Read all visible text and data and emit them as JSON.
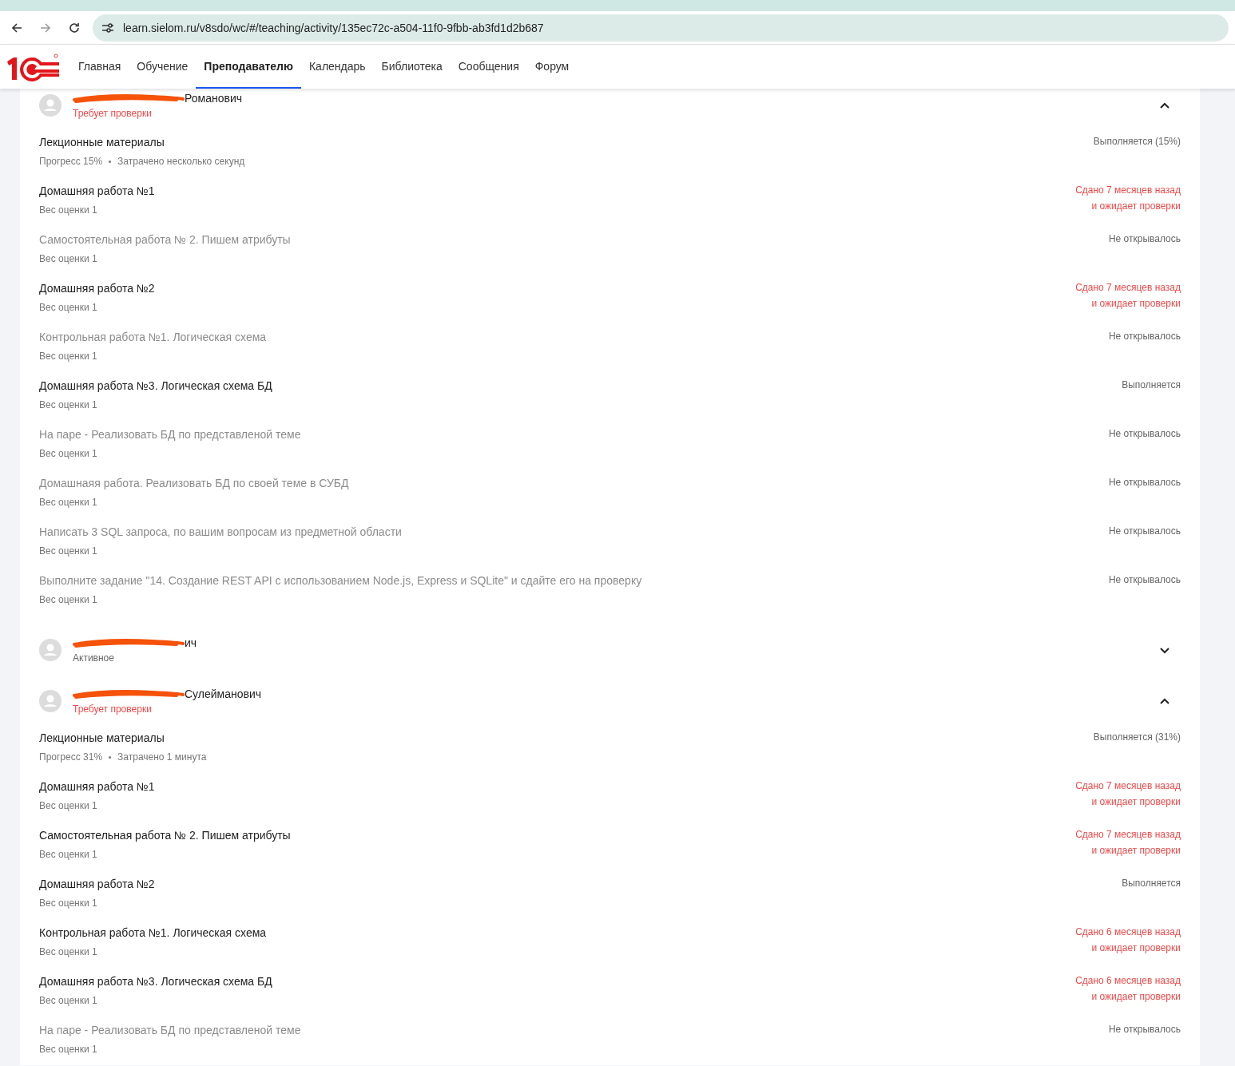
{
  "browser": {
    "url": "learn.sielom.ru/v8sdo/wc/#/teaching/activity/135ec72c-a504-11f0-9fbb-ab3fd1d2b687"
  },
  "nav": [
    {
      "label": "Главная",
      "selected": false
    },
    {
      "label": "Обучение",
      "selected": false
    },
    {
      "label": "Преподавателю",
      "selected": true
    },
    {
      "label": "Календарь",
      "selected": false
    },
    {
      "label": "Библиотека",
      "selected": false
    },
    {
      "label": "Сообщения",
      "selected": false
    },
    {
      "label": "Форум",
      "selected": false
    }
  ],
  "students": [
    {
      "name_visible": "Романович",
      "status": "Требует проверки",
      "needs_review": true,
      "expanded": true,
      "items": [
        {
          "title": "Лекционные материалы",
          "opened": true,
          "meta": [
            "Прогресс 15%",
            "Затрачено несколько секунд"
          ],
          "status": [
            "Выполняется (15%)"
          ],
          "needs_review": false
        },
        {
          "title": "Домашняя работа №1",
          "opened": true,
          "meta": [
            "Вес оценки 1"
          ],
          "status": [
            "Сдано 7 месяцев назад",
            "и ожидает проверки"
          ],
          "needs_review": true
        },
        {
          "title": "Самостоятельная работа № 2. Пишем атрибуты",
          "opened": false,
          "meta": [
            "Вес оценки 1"
          ],
          "status": [
            "Не открывалось"
          ],
          "needs_review": false
        },
        {
          "title": "Домашняя работа №2",
          "opened": true,
          "meta": [
            "Вес оценки 1"
          ],
          "status": [
            "Сдано 7 месяцев назад",
            "и ожидает проверки"
          ],
          "needs_review": true
        },
        {
          "title": "Контрольная работа №1. Логическая схема",
          "opened": false,
          "meta": [
            "Вес оценки 1"
          ],
          "status": [
            "Не открывалось"
          ],
          "needs_review": false
        },
        {
          "title": "Домашняя работа №3. Логическая схема БД",
          "opened": true,
          "meta": [
            "Вес оценки 1"
          ],
          "status": [
            "Выполняется"
          ],
          "needs_review": false
        },
        {
          "title": "На паре - Реализовать БД по представленой теме",
          "opened": false,
          "meta": [
            "Вес оценки 1"
          ],
          "status": [
            "Не открывалось"
          ],
          "needs_review": false
        },
        {
          "title": "Домашнаяя работа. Реализовать БД по своей теме в СУБД",
          "opened": false,
          "meta": [
            "Вес оценки 1"
          ],
          "status": [
            "Не открывалось"
          ],
          "needs_review": false
        },
        {
          "title": "Написать 3 SQL запроса, по вашим вопросам из предметной области",
          "opened": false,
          "meta": [
            "Вес оценки 1"
          ],
          "status": [
            "Не открывалось"
          ],
          "needs_review": false
        },
        {
          "title": "Выполните задание \"14. Создание REST API с использованием Node.js, Express и SQLite\" и сдайте его на проверку",
          "opened": false,
          "meta": [
            "Вес оценки 1"
          ],
          "status": [
            "Не открывалось"
          ],
          "needs_review": false
        }
      ]
    },
    {
      "name_visible": "ич",
      "status": "Активное",
      "needs_review": false,
      "expanded": false
    },
    {
      "name_visible": "Сулейманович",
      "status": "Требует проверки",
      "needs_review": true,
      "expanded": true,
      "items": [
        {
          "title": "Лекционные материалы",
          "opened": true,
          "meta": [
            "Прогресс 31%",
            "Затрачено 1 минута"
          ],
          "status": [
            "Выполняется (31%)"
          ],
          "needs_review": false
        },
        {
          "title": "Домашняя работа №1",
          "opened": true,
          "meta": [
            "Вес оценки 1"
          ],
          "status": [
            "Сдано 7 месяцев назад",
            "и ожидает проверки"
          ],
          "needs_review": true
        },
        {
          "title": "Самостоятельная работа № 2. Пишем атрибуты",
          "opened": true,
          "meta": [
            "Вес оценки 1"
          ],
          "status": [
            "Сдано 7 месяцев назад",
            "и ожидает проверки"
          ],
          "needs_review": true
        },
        {
          "title": "Домашняя работа №2",
          "opened": true,
          "meta": [
            "Вес оценки 1"
          ],
          "status": [
            "Выполняется"
          ],
          "needs_review": false
        },
        {
          "title": "Контрольная работа №1. Логическая схема",
          "opened": true,
          "meta": [
            "Вес оценки 1"
          ],
          "status": [
            "Сдано 6 месяцев назад",
            "и ожидает проверки"
          ],
          "needs_review": true
        },
        {
          "title": "Домашняя работа №3. Логическая схема БД",
          "opened": true,
          "meta": [
            "Вес оценки 1"
          ],
          "status": [
            "Сдано 6 месяцев назад",
            "и ожидает проверки"
          ],
          "needs_review": true
        },
        {
          "title": "На паре - Реализовать БД по представленой теме",
          "opened": false,
          "meta": [
            "Вес оценки 1"
          ],
          "status": [
            "Не открывалось"
          ],
          "needs_review": false
        }
      ]
    }
  ]
}
